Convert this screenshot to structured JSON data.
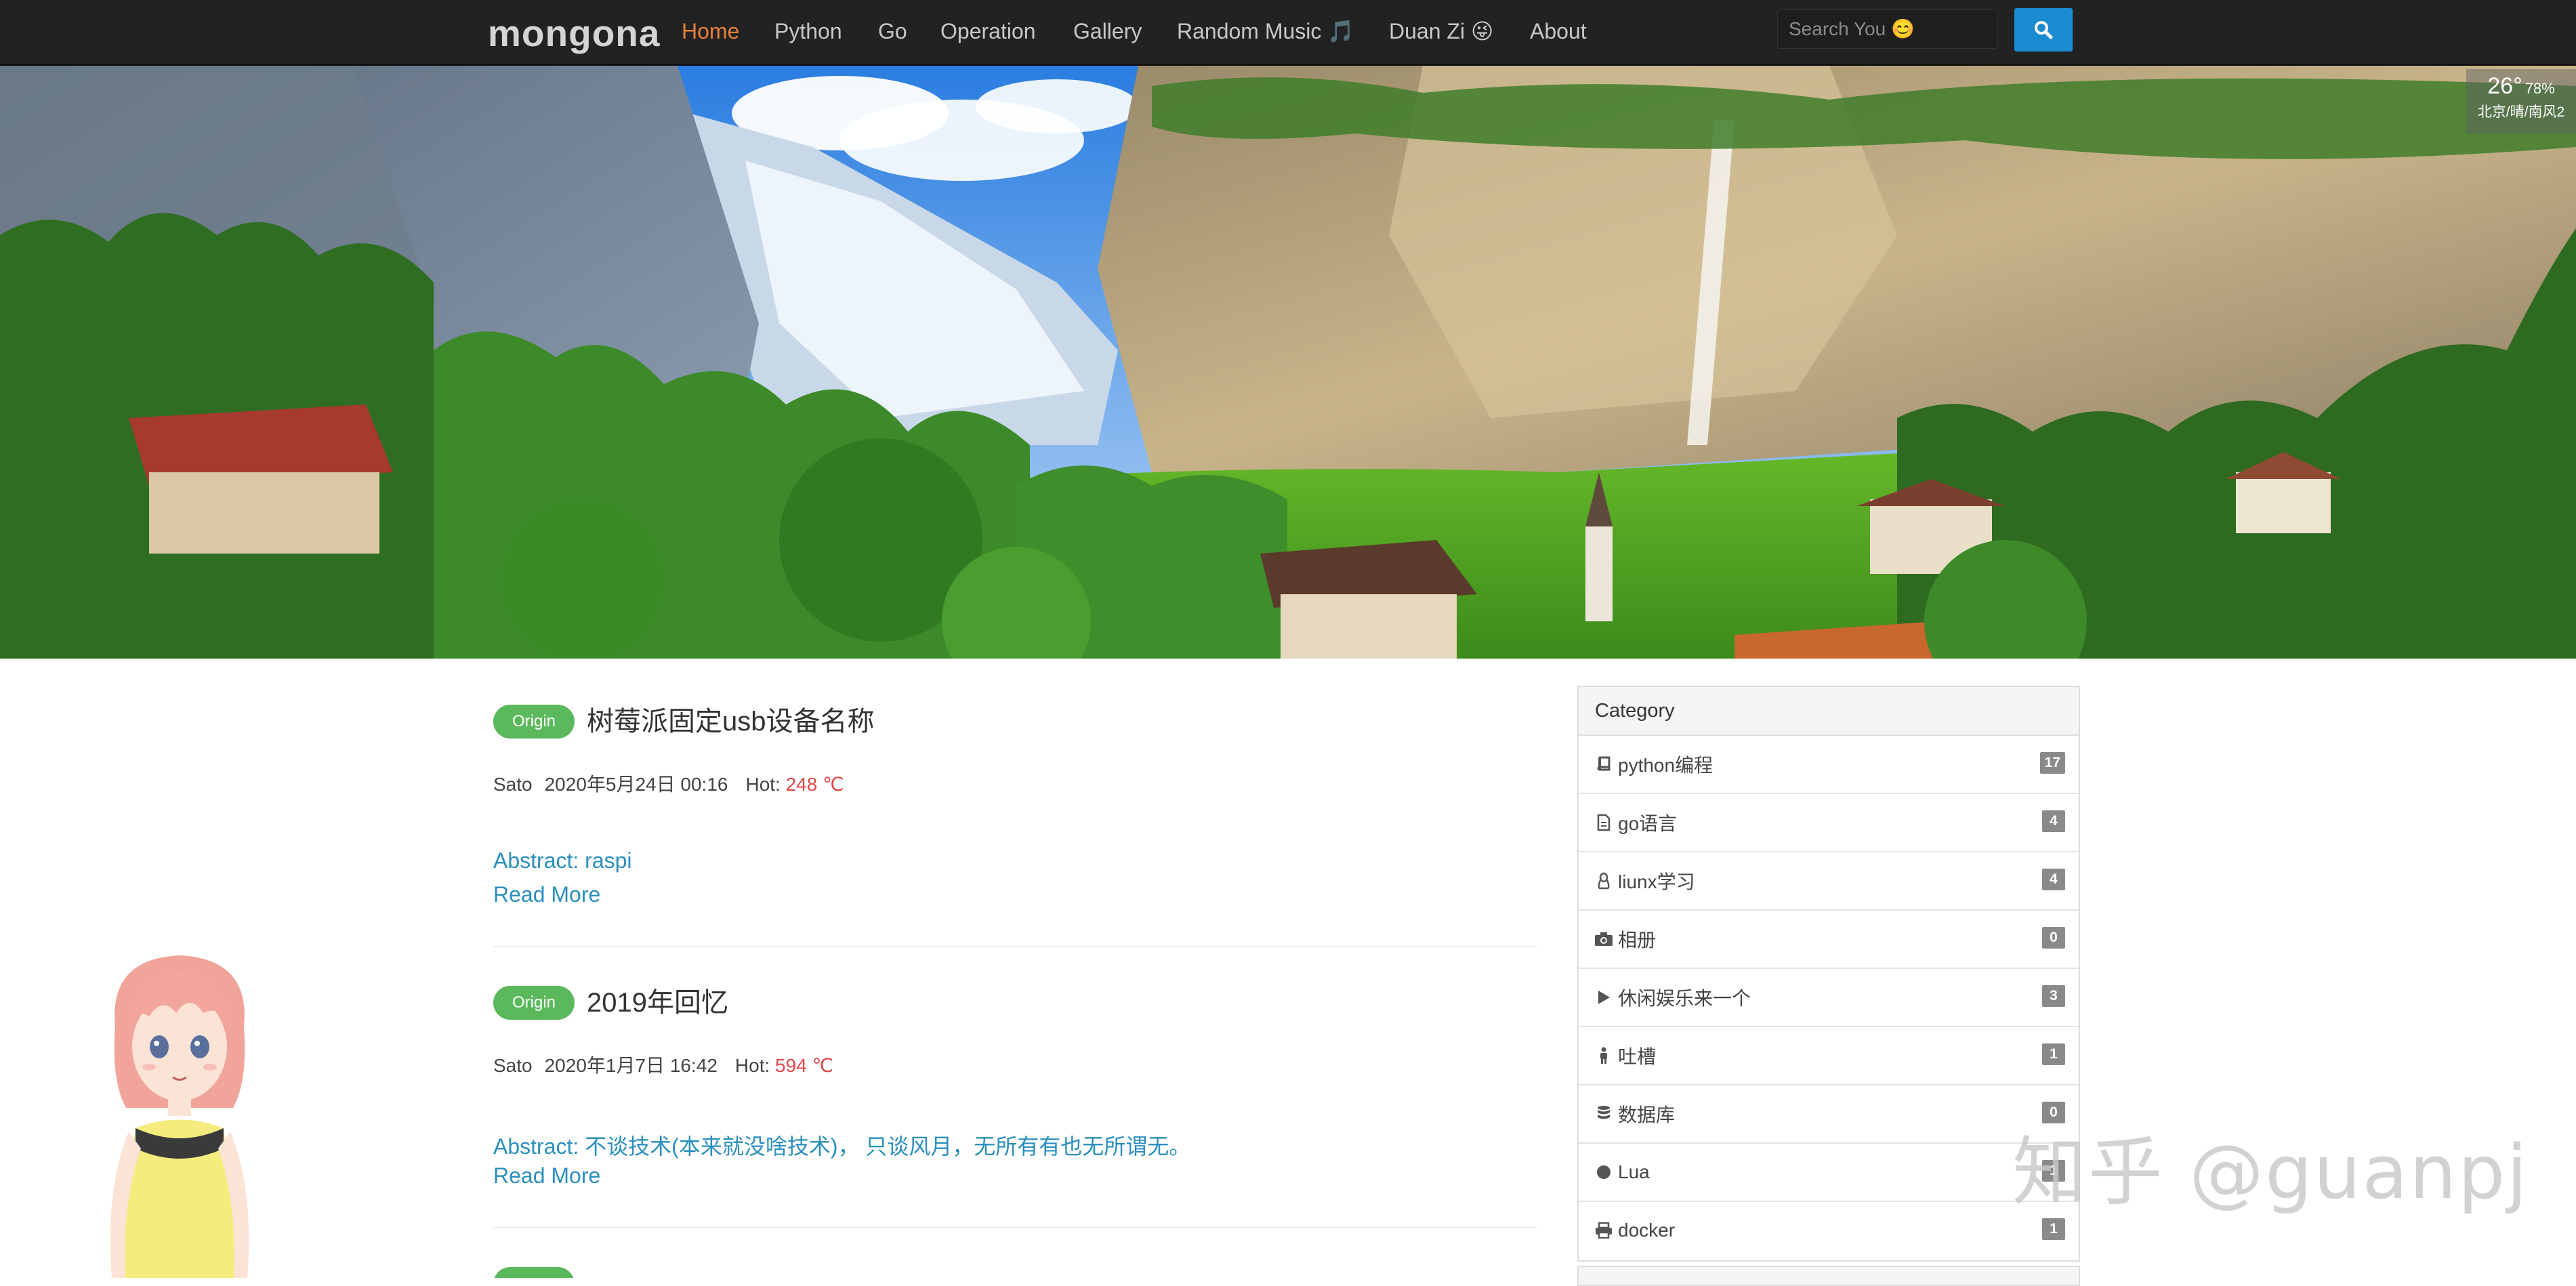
{
  "navbar": {
    "brand": "mongona",
    "items": [
      {
        "label": "Home",
        "active": true
      },
      {
        "label": "Python"
      },
      {
        "label": "Go"
      },
      {
        "label": "Operation"
      },
      {
        "label": "Gallery"
      },
      {
        "label": "Random Music 🎵"
      },
      {
        "label": "Duan Zi 😜"
      },
      {
        "label": "About"
      }
    ],
    "search_placeholder": "Search You 😊",
    "search_icon": "search-icon"
  },
  "weather": {
    "temperature": "26°",
    "humidity": "78%",
    "condition": "北京/晴/南风2"
  },
  "posts": [
    {
      "badge": "Origin",
      "title": "树莓派固定usb设备名称",
      "author": "Sato",
      "date": "2020年5月24日 00:16",
      "hot_label": "Hot:",
      "hot_value": "248 ℃",
      "abstract": "Abstract:  raspi",
      "read_more": "Read More"
    },
    {
      "badge": "Origin",
      "title": "2019年回忆",
      "author": "Sato",
      "date": "2020年1月7日 16:42",
      "hot_label": "Hot:",
      "hot_value": "594 ℃",
      "abstract": "Abstract:  不谈技术(本来就没啥技术)， 只谈风月，无所有有也无所谓无。",
      "read_more": "Read More"
    }
  ],
  "sidebar": {
    "heading": "Category",
    "categories": [
      {
        "icon": "book-icon",
        "label": "python编程",
        "count": "17"
      },
      {
        "icon": "file-icon",
        "label": "go语言",
        "count": "4"
      },
      {
        "icon": "linux-icon",
        "label": "liunx学习",
        "count": "4"
      },
      {
        "icon": "camera-icon",
        "label": "相册",
        "count": "0"
      },
      {
        "icon": "play-icon",
        "label": "休闲娱乐来一个",
        "count": "3"
      },
      {
        "icon": "person-icon",
        "label": "吐槽",
        "count": "1"
      },
      {
        "icon": "database-icon",
        "label": "数据库",
        "count": "0"
      },
      {
        "icon": "circle-icon",
        "label": "Lua",
        "count": "1"
      },
      {
        "icon": "printer-icon",
        "label": "docker",
        "count": "1"
      }
    ]
  },
  "watermark": "知乎 @guanpj"
}
